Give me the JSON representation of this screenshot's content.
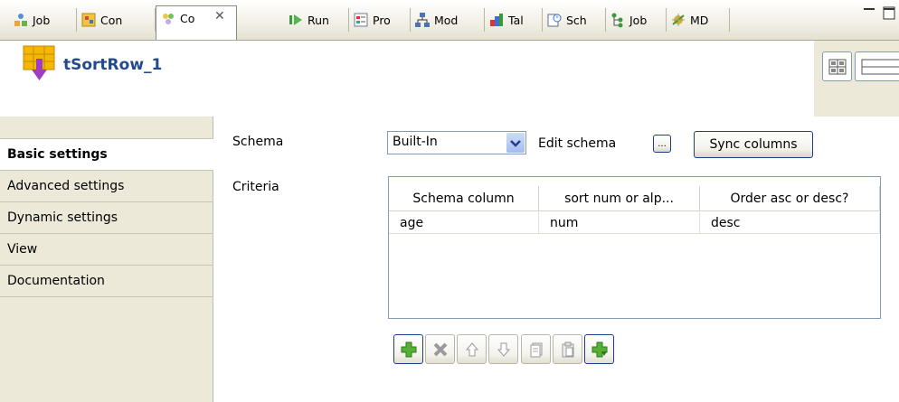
{
  "tabs": [
    {
      "label": "Job",
      "icon": "job-icon"
    },
    {
      "label": "Con",
      "icon": "contexts-icon"
    },
    {
      "label": "Co",
      "icon": "component-icon",
      "active": true
    },
    {
      "label": "Run",
      "icon": "run-icon"
    },
    {
      "label": "Pro",
      "icon": "problems-icon"
    },
    {
      "label": "Mod",
      "icon": "modules-icon"
    },
    {
      "label": "Tal",
      "icon": "talend-icon"
    },
    {
      "label": "Sch",
      "icon": "scheduler-icon"
    },
    {
      "label": "Job",
      "icon": "job-hierarchy-icon"
    },
    {
      "label": "MD",
      "icon": "metadata-icon"
    }
  ],
  "header": {
    "title": "tSortRow_1"
  },
  "left_tabs": [
    {
      "label": "Basic settings",
      "active": true
    },
    {
      "label": "Advanced settings"
    },
    {
      "label": "Dynamic settings"
    },
    {
      "label": "View"
    },
    {
      "label": "Documentation"
    }
  ],
  "form": {
    "schema_label": "Schema",
    "schema_value": "Built-In",
    "edit_schema_label": "Edit schema",
    "edit_schema_button": "...",
    "sync_columns_button": "Sync columns",
    "criteria_label": "Criteria"
  },
  "table": {
    "columns": [
      "Schema column",
      "sort num or alp...",
      "Order asc or desc?"
    ],
    "rows": [
      [
        "age",
        "num",
        "desc"
      ]
    ]
  },
  "toolbar": [
    "add-icon",
    "remove-icon",
    "move-up-icon",
    "move-down-icon",
    "copy-icon",
    "paste-icon",
    "add-all-icon"
  ],
  "colors": {
    "accent": "#1e3e8c",
    "title": "#224a8c",
    "panel_bg": "#ece9d8"
  }
}
